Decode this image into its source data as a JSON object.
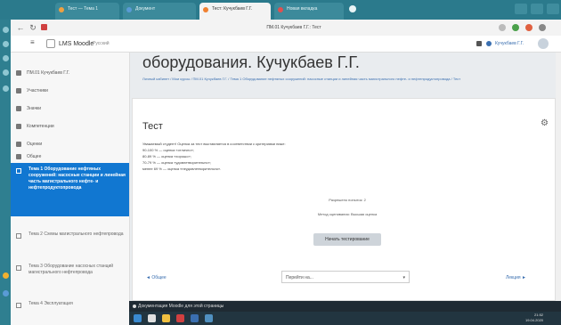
{
  "browser": {
    "tabs": [
      {
        "label": "Тест — Тема 1",
        "active": false
      },
      {
        "label": "Документ",
        "active": false
      },
      {
        "label": "Тест: Кучукбаев Г.Г.",
        "active": true
      },
      {
        "label": "Новая вкладка",
        "active": false
      }
    ],
    "url": "ПМ.01 Кучукбаев Г.Г.: Тест"
  },
  "header": {
    "logo": "LMS Moodle",
    "site_label": "Русский",
    "user": "Кучукбаев Г.Г."
  },
  "sidebar": {
    "items": [
      {
        "label": "ПМ.01 Кучукбаев Г.Г."
      },
      {
        "label": "Участники"
      },
      {
        "label": "Значки"
      },
      {
        "label": "Компетенции"
      },
      {
        "label": "Оценки"
      },
      {
        "label": "Общее"
      }
    ],
    "active_section": "Тема 1 Оборудование нефтяных сооружений: насосные станции и линейная часть магистрального нефте- и нефтепродуктопровода",
    "next_sections": [
      "Тема 2 Схемы магистрального нефтепровода",
      "Тема 3 Оборудование насосных станций магистрального нефтепровода",
      "Тема 4 Эксплуатация"
    ]
  },
  "main": {
    "page_title": "оборудования. Кучукбаев Г.Г.",
    "breadcrumb": "Личный кабинет / Мои курсы / ПМ.01 Кучукбаев Г.Г. / Тема 1 Оборудование нефтяных сооружений: насосные станции и линейная часть магистрального нефте- и нефтепродуктопровода / Тест",
    "quiz_title": "Тест",
    "info_lines": [
      "Уважаемый студент! Оценка за тест выставляется в соответствии с критериями ниже:",
      "90-100 % — оценка «отлично»;",
      "80-89 % — оценка «хорошо»;",
      "70-79 % — оценка «удовлетворительно»;",
      "менее 69 % — оценка «неудовлетворительно»."
    ],
    "attempts_allowed": "Разрешено попыток: 2",
    "grading_method": "Метод оценивания: Высшая оценка",
    "start_button": "Начать тестирование",
    "prev_link": "◄ Общее",
    "jump_placeholder": "Перейти на...",
    "next_link": "Лекция ►"
  },
  "footer": {
    "text": "Документация Moodle для этой страницы"
  },
  "taskbar": {
    "time": "21:52",
    "date": "19.04.2020"
  }
}
